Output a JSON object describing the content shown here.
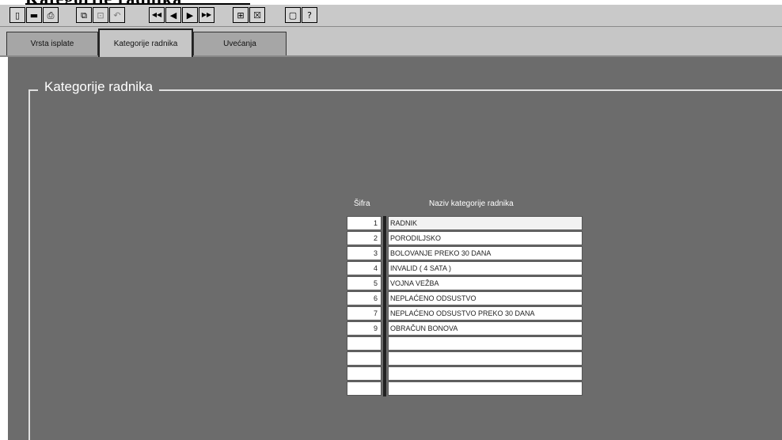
{
  "window": {
    "title_cut": "Kategorije radnika"
  },
  "toolbar": {
    "groups": [
      [
        {
          "icon": "open-icon",
          "glyph": "▯"
        },
        {
          "icon": "save-icon",
          "glyph": "▬"
        },
        {
          "icon": "print-icon",
          "glyph": "⎙"
        }
      ],
      [
        {
          "icon": "copy-icon",
          "glyph": "⧉"
        },
        {
          "icon": "paste-icon",
          "glyph": "⊡",
          "dim": true
        },
        {
          "icon": "undo-icon",
          "glyph": "↶",
          "dim": true
        }
      ],
      [
        {
          "icon": "first-record-icon",
          "glyph": "◀◀"
        },
        {
          "icon": "previous-record-icon",
          "glyph": "◀"
        },
        {
          "icon": "next-record-icon",
          "glyph": "▶"
        },
        {
          "icon": "last-record-icon",
          "glyph": "▶▶"
        }
      ],
      [
        {
          "icon": "add-record-icon",
          "glyph": "⊞"
        },
        {
          "icon": "delete-record-icon",
          "glyph": "☒"
        }
      ],
      [
        {
          "icon": "window-icon",
          "glyph": "▢"
        },
        {
          "icon": "help-icon",
          "glyph": "?"
        }
      ]
    ]
  },
  "tabs": [
    {
      "label": "Vrsta isplate",
      "active": false
    },
    {
      "label": "Kategorije radnika",
      "active": true
    },
    {
      "label": "Uvećanja",
      "active": false
    }
  ],
  "form": {
    "legend": "Kategorije radnika",
    "col_code": "Šifra",
    "col_name": "Naziv kategorije radnika",
    "rows": [
      {
        "code": "1",
        "name": "RADNIK"
      },
      {
        "code": "2",
        "name": "PORODILJSKO"
      },
      {
        "code": "3",
        "name": "BOLOVANJE PREKO 30 DANA"
      },
      {
        "code": "4",
        "name": "INVALID ( 4 SATA )"
      },
      {
        "code": "5",
        "name": "VOJNA VEŽBA"
      },
      {
        "code": "6",
        "name": "NEPLAĆENO ODSUSTVO"
      },
      {
        "code": "7",
        "name": "NEPLAĆENO ODSUSTVO PREKO 30 DANA"
      },
      {
        "code": "9",
        "name": "OBRAČUN BONOVA"
      },
      {
        "code": "",
        "name": ""
      },
      {
        "code": "",
        "name": ""
      },
      {
        "code": "",
        "name": ""
      },
      {
        "code": "",
        "name": ""
      }
    ],
    "current_row": 0
  }
}
